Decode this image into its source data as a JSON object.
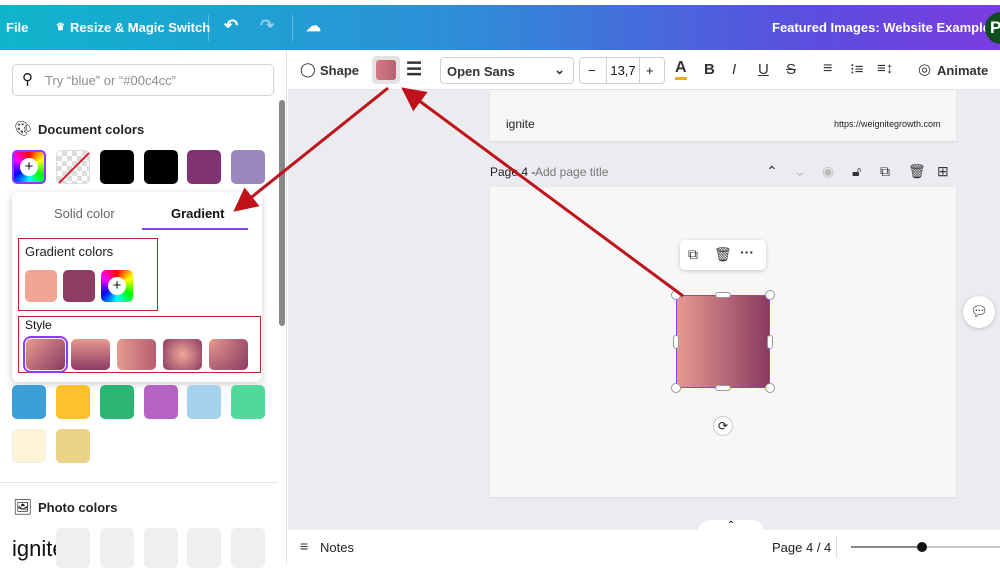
{
  "topbar": {
    "file": "File",
    "resize": "Resize & Magic Switch",
    "title": "Featured Images: Website Examples",
    "avatar": "P"
  },
  "left": {
    "search_placeholder": "Try “blue” or “#00c4cc”",
    "document_colors": "Document colors",
    "doc_swatches": [
      "#000000",
      "#000000",
      "#7f3372",
      "#9987bd"
    ],
    "popup": {
      "tab_solid": "Solid color",
      "tab_gradient": "Gradient",
      "gradient_colors_label": "Gradient colors",
      "gradient_colors": [
        "#f3a595",
        "#8d3d63"
      ],
      "style_label": "Style"
    },
    "more_swatches": [
      "#3d9fd8",
      "#fdc22b",
      "#2bb673",
      "#b462c4",
      "#a5d2ea",
      "#52d89a",
      "#fff4d6",
      "#ecd188"
    ],
    "photo_colors": "Photo colors"
  },
  "toolbar": {
    "shape": "Shape",
    "font": "Open Sans",
    "font_size": "13,7",
    "animate": "Animate",
    "fill_color": "#d47b86"
  },
  "canvas": {
    "logo": "ignite",
    "url": "https://weignitegrowth.com",
    "page_label": "Page 4 - ",
    "page_title_placeholder": "Add page title",
    "shape_gradient": [
      "#e79a8f",
      "#8a3a62"
    ]
  },
  "bottom": {
    "notes": "Notes",
    "page_indicator": "Page 4 / 4",
    "zoom_fraction": 0.5
  },
  "accent": "#8b3dff",
  "annotation_color": "#c0121b"
}
